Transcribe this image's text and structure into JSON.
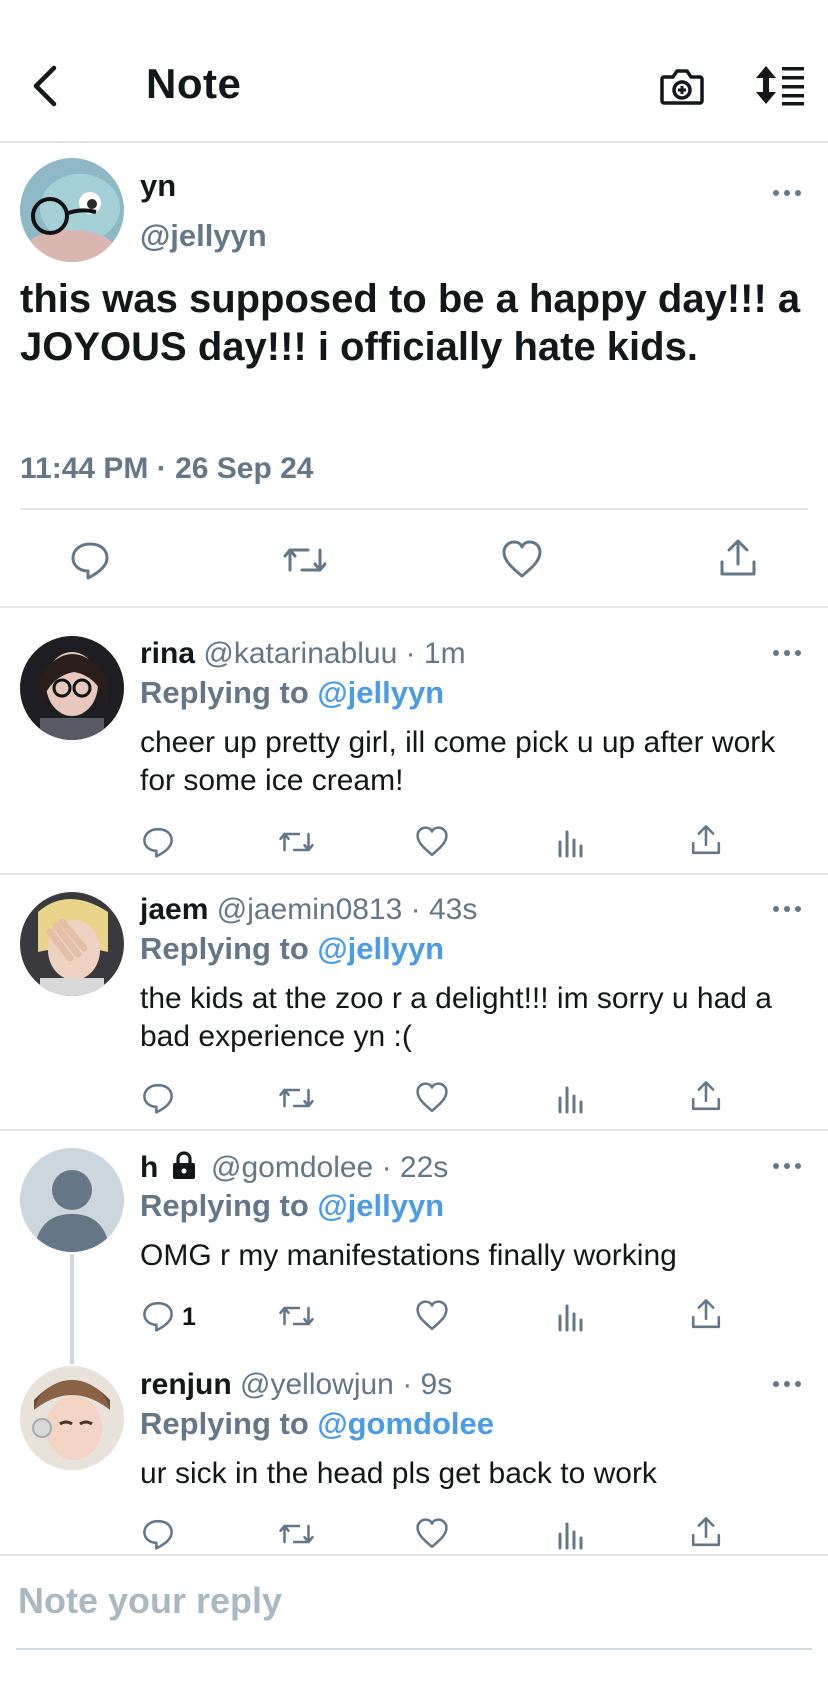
{
  "header": {
    "title": "Note",
    "back_icon": "chevron-left-icon",
    "camera_icon": "camera-add-icon",
    "sort_icon": "sort-list-icon"
  },
  "main_post": {
    "display_name": "yn",
    "handle": "@jellyyn",
    "text": "this was supposed to be a happy day!!! a JOYOUS day!!! i officially hate kids.",
    "timestamp": "11:44 PM · 26 Sep 24"
  },
  "replies": [
    {
      "display_name": "rina",
      "meta": "@katarinabluu · 1m",
      "replying_prefix": "Replying to ",
      "replying_to": "@jellyyn",
      "text": "cheer up pretty girl, ill come pick u up after work for some ice cream!"
    },
    {
      "display_name": "jaem",
      "meta": "@jaemin0813 · 43s",
      "replying_prefix": "Replying to ",
      "replying_to": "@jellyyn",
      "text": "the kids at the zoo r a delight!!! im sorry u had a bad experience yn :("
    },
    {
      "display_name": "h",
      "meta": "@gomdolee · 22s",
      "replying_prefix": "Replying to ",
      "replying_to": "@jellyyn",
      "text": "OMG r my manifestations finally working",
      "reply_count": "1",
      "locked": true
    },
    {
      "display_name": "renjun",
      "meta": "@yellowjun · 9s",
      "replying_prefix": "Replying to ",
      "replying_to": "@gomdolee",
      "text": "ur sick in the head pls get back to work"
    }
  ],
  "compose": {
    "placeholder": "Note your reply"
  },
  "colors": {
    "text": "#14171a",
    "secondary": "#657786",
    "link": "#4c9be6",
    "divider": "#e1e6ea"
  }
}
